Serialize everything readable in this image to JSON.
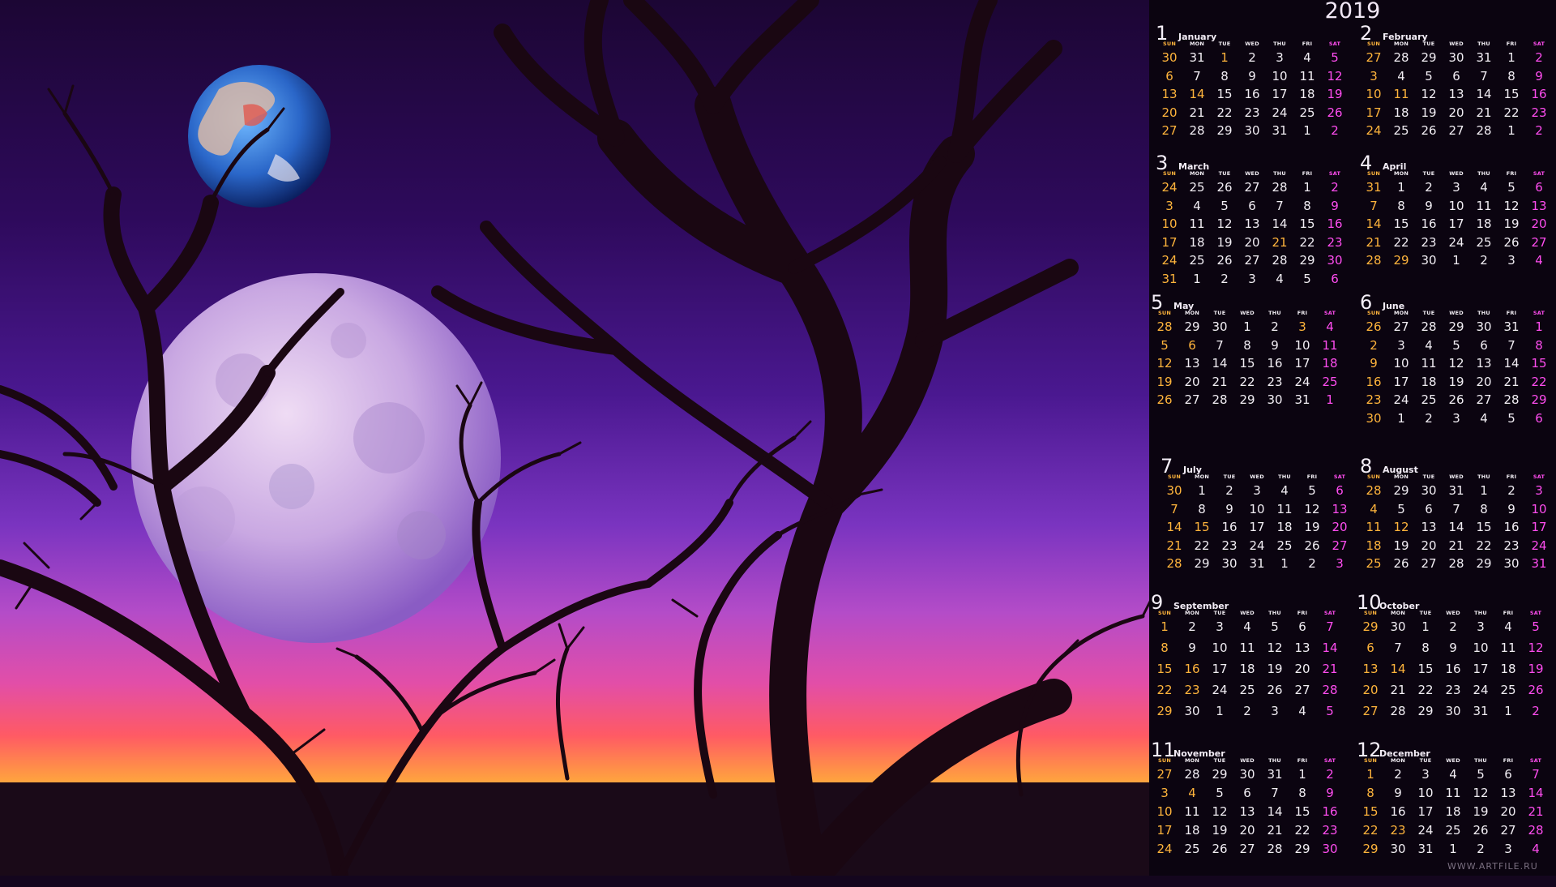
{
  "year": "2019",
  "watermark": "WWW.ARTFILE.RU",
  "dow_labels": [
    "SUN",
    "MON",
    "TUE",
    "WED",
    "THU",
    "FRI",
    "SAT"
  ],
  "colors": {
    "weekday": "#f2eef4",
    "sunday": "#ffb43c",
    "saturday": "#ff4df0",
    "holiday": "#ffb43c",
    "panel": "#0b0410"
  },
  "months": [
    {
      "num": "1",
      "name": "January",
      "weeks": [
        [
          "30",
          "31",
          "1",
          "2",
          "3",
          "4",
          "5"
        ],
        [
          "6",
          "7",
          "8",
          "9",
          "10",
          "11",
          "12"
        ],
        [
          "13",
          "14",
          "15",
          "16",
          "17",
          "18",
          "19"
        ],
        [
          "20",
          "21",
          "22",
          "23",
          "24",
          "25",
          "26"
        ],
        [
          "27",
          "28",
          "29",
          "30",
          "31",
          "1",
          "2"
        ]
      ],
      "holidays": [
        "1",
        "14"
      ]
    },
    {
      "num": "2",
      "name": "February",
      "weeks": [
        [
          "27",
          "28",
          "29",
          "30",
          "31",
          "1",
          "2"
        ],
        [
          "3",
          "4",
          "5",
          "6",
          "7",
          "8",
          "9"
        ],
        [
          "10",
          "11",
          "12",
          "13",
          "14",
          "15",
          "16"
        ],
        [
          "17",
          "18",
          "19",
          "20",
          "21",
          "22",
          "23"
        ],
        [
          "24",
          "25",
          "26",
          "27",
          "28",
          "1",
          "2"
        ]
      ],
      "holidays": [
        "11"
      ]
    },
    {
      "num": "3",
      "name": "March",
      "weeks": [
        [
          "24",
          "25",
          "26",
          "27",
          "28",
          "1",
          "2"
        ],
        [
          "3",
          "4",
          "5",
          "6",
          "7",
          "8",
          "9"
        ],
        [
          "10",
          "11",
          "12",
          "13",
          "14",
          "15",
          "16"
        ],
        [
          "17",
          "18",
          "19",
          "20",
          "21",
          "22",
          "23"
        ],
        [
          "24",
          "25",
          "26",
          "27",
          "28",
          "29",
          "30"
        ],
        [
          "31",
          "1",
          "2",
          "3",
          "4",
          "5",
          "6"
        ]
      ],
      "holidays": [
        "21"
      ]
    },
    {
      "num": "4",
      "name": "April",
      "weeks": [
        [
          "31",
          "1",
          "2",
          "3",
          "4",
          "5",
          "6"
        ],
        [
          "7",
          "8",
          "9",
          "10",
          "11",
          "12",
          "13"
        ],
        [
          "14",
          "15",
          "16",
          "17",
          "18",
          "19",
          "20"
        ],
        [
          "21",
          "22",
          "23",
          "24",
          "25",
          "26",
          "27"
        ],
        [
          "28",
          "29",
          "30",
          "1",
          "2",
          "3",
          "4"
        ]
      ],
      "holidays": [
        "29"
      ]
    },
    {
      "num": "5",
      "name": "May",
      "weeks": [
        [
          "28",
          "29",
          "30",
          "1",
          "2",
          "3",
          "4"
        ],
        [
          "5",
          "6",
          "7",
          "8",
          "9",
          "10",
          "11"
        ],
        [
          "12",
          "13",
          "14",
          "15",
          "16",
          "17",
          "18"
        ],
        [
          "19",
          "20",
          "21",
          "22",
          "23",
          "24",
          "25"
        ],
        [
          "26",
          "27",
          "28",
          "29",
          "30",
          "31",
          "1"
        ]
      ],
      "holidays": [
        "3",
        "6"
      ]
    },
    {
      "num": "6",
      "name": "June",
      "weeks": [
        [
          "26",
          "27",
          "28",
          "29",
          "30",
          "31",
          "1"
        ],
        [
          "2",
          "3",
          "4",
          "5",
          "6",
          "7",
          "8"
        ],
        [
          "9",
          "10",
          "11",
          "12",
          "13",
          "14",
          "15"
        ],
        [
          "16",
          "17",
          "18",
          "19",
          "20",
          "21",
          "22"
        ],
        [
          "23",
          "24",
          "25",
          "26",
          "27",
          "28",
          "29"
        ],
        [
          "30",
          "1",
          "2",
          "3",
          "4",
          "5",
          "6"
        ]
      ],
      "holidays": []
    },
    {
      "num": "7",
      "name": "July",
      "weeks": [
        [
          "30",
          "1",
          "2",
          "3",
          "4",
          "5",
          "6"
        ],
        [
          "7",
          "8",
          "9",
          "10",
          "11",
          "12",
          "13"
        ],
        [
          "14",
          "15",
          "16",
          "17",
          "18",
          "19",
          "20"
        ],
        [
          "21",
          "22",
          "23",
          "24",
          "25",
          "26",
          "27"
        ],
        [
          "28",
          "29",
          "30",
          "31",
          "1",
          "2",
          "3"
        ]
      ],
      "holidays": [
        "15"
      ]
    },
    {
      "num": "8",
      "name": "August",
      "weeks": [
        [
          "28",
          "29",
          "30",
          "31",
          "1",
          "2",
          "3"
        ],
        [
          "4",
          "5",
          "6",
          "7",
          "8",
          "9",
          "10"
        ],
        [
          "11",
          "12",
          "13",
          "14",
          "15",
          "16",
          "17"
        ],
        [
          "18",
          "19",
          "20",
          "21",
          "22",
          "23",
          "24"
        ],
        [
          "25",
          "26",
          "27",
          "28",
          "29",
          "30",
          "31"
        ]
      ],
      "holidays": [
        "12"
      ]
    },
    {
      "num": "9",
      "name": "September",
      "weeks": [
        [
          "1",
          "2",
          "3",
          "4",
          "5",
          "6",
          "7"
        ],
        [
          "8",
          "9",
          "10",
          "11",
          "12",
          "13",
          "14"
        ],
        [
          "15",
          "16",
          "17",
          "18",
          "19",
          "20",
          "21"
        ],
        [
          "22",
          "23",
          "24",
          "25",
          "26",
          "27",
          "28"
        ],
        [
          "29",
          "30",
          "1",
          "2",
          "3",
          "4",
          "5"
        ]
      ],
      "holidays": [
        "16",
        "23"
      ]
    },
    {
      "num": "10",
      "name": "October",
      "weeks": [
        [
          "29",
          "30",
          "1",
          "2",
          "3",
          "4",
          "5"
        ],
        [
          "6",
          "7",
          "8",
          "9",
          "10",
          "11",
          "12"
        ],
        [
          "13",
          "14",
          "15",
          "16",
          "17",
          "18",
          "19"
        ],
        [
          "20",
          "21",
          "22",
          "23",
          "24",
          "25",
          "26"
        ],
        [
          "27",
          "28",
          "29",
          "30",
          "31",
          "1",
          "2"
        ]
      ],
      "holidays": [
        "14"
      ]
    },
    {
      "num": "11",
      "name": "November",
      "weeks": [
        [
          "27",
          "28",
          "29",
          "30",
          "31",
          "1",
          "2"
        ],
        [
          "3",
          "4",
          "5",
          "6",
          "7",
          "8",
          "9"
        ],
        [
          "10",
          "11",
          "12",
          "13",
          "14",
          "15",
          "16"
        ],
        [
          "17",
          "18",
          "19",
          "20",
          "21",
          "22",
          "23"
        ],
        [
          "24",
          "25",
          "26",
          "27",
          "28",
          "29",
          "30"
        ]
      ],
      "holidays": [
        "4"
      ]
    },
    {
      "num": "12",
      "name": "December",
      "weeks": [
        [
          "1",
          "2",
          "3",
          "4",
          "5",
          "6",
          "7"
        ],
        [
          "8",
          "9",
          "10",
          "11",
          "12",
          "13",
          "14"
        ],
        [
          "15",
          "16",
          "17",
          "18",
          "19",
          "20",
          "21"
        ],
        [
          "22",
          "23",
          "24",
          "25",
          "26",
          "27",
          "28"
        ],
        [
          "29",
          "30",
          "31",
          "1",
          "2",
          "3",
          "4"
        ]
      ],
      "holidays": [
        "23"
      ]
    }
  ]
}
